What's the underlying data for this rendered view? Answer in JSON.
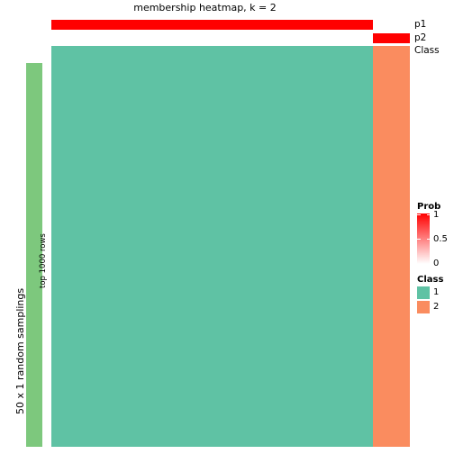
{
  "title": "membership heatmap, k = 2",
  "left_axis": {
    "title": "50 x 1 random samplings",
    "row_annotation_label": "top 1000 rows",
    "row_annotation_color": "#7DC87D"
  },
  "top_annotations": [
    {
      "name": "p1",
      "label": "p1",
      "segments": [
        {
          "from": 0.0,
          "to": 0.897,
          "color": "#FF0000",
          "prob": 1
        },
        {
          "from": 0.897,
          "to": 1.0,
          "color": "#FFFFFF",
          "prob": 0
        }
      ]
    },
    {
      "name": "p2",
      "label": "p2",
      "segments": [
        {
          "from": 0.0,
          "to": 0.897,
          "color": "#FFFFFF",
          "prob": 0
        },
        {
          "from": 0.897,
          "to": 1.0,
          "color": "#FF0000",
          "prob": 1
        }
      ]
    },
    {
      "name": "Class",
      "label": "Class",
      "segments": [
        {
          "from": 0.0,
          "to": 0.897,
          "color": "#5FC2A4",
          "class": 1
        },
        {
          "from": 0.897,
          "to": 1.0,
          "color": "#FA8C5F",
          "class": 2
        }
      ]
    }
  ],
  "heatmap": {
    "columns": [
      {
        "from": 0.0,
        "to": 0.897,
        "color": "#5FC2A4",
        "class": 1
      },
      {
        "from": 0.897,
        "to": 1.0,
        "color": "#FA8C5F",
        "class": 2
      }
    ]
  },
  "legends": {
    "prob": {
      "title": "Prob",
      "ticks": [
        "1",
        "0.5",
        "0"
      ],
      "top_color": "#FF0000",
      "bottom_color": "#FFFFFF"
    },
    "class": {
      "title": "Class",
      "items": [
        {
          "label": "1",
          "color": "#5FC2A4"
        },
        {
          "label": "2",
          "color": "#FA8C5F"
        }
      ]
    }
  },
  "chart_data": {
    "type": "heatmap",
    "title": "membership heatmap, k = 2",
    "xlabel": "",
    "ylabel": "50 x 1 random samplings",
    "row_annotation": "top 1000 rows",
    "k": 2,
    "n_rows": 50,
    "n_top_rows": 1000,
    "class_fraction": {
      "1": 0.897,
      "2": 0.103
    },
    "categories": [
      "class 1 columns",
      "class 2 columns"
    ],
    "values": [
      0.897,
      0.103
    ],
    "series": [
      {
        "name": "p1",
        "values": [
          1,
          0
        ]
      },
      {
        "name": "p2",
        "values": [
          0,
          1
        ]
      },
      {
        "name": "Class",
        "values": [
          1,
          2
        ]
      }
    ],
    "prob_range": [
      0,
      1
    ],
    "prob_ticks": [
      0,
      0.5,
      1
    ],
    "legend_position": "right",
    "grid": false
  }
}
